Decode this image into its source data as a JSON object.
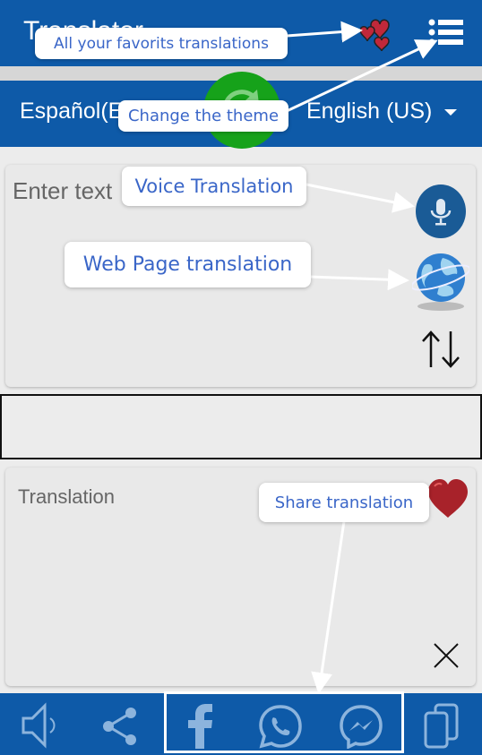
{
  "header": {
    "title": "Translator",
    "favorites_icon": "hearts-icon",
    "menu_icon": "list-menu-icon"
  },
  "languages": {
    "source": "Español(E",
    "target": "English (US)",
    "swap_icon": "refresh-icon"
  },
  "input": {
    "placeholder": "Enter text",
    "mic_icon": "microphone-icon",
    "web_icon": "globe-icon",
    "swap_icon": "up-down-arrows-icon"
  },
  "output": {
    "placeholder": "Translation",
    "favorite_icon": "heart-icon",
    "clear_icon": "close-icon"
  },
  "bottom_bar": {
    "icons": [
      "speaker-icon",
      "share-icon",
      "facebook-icon",
      "whatsapp-icon",
      "messenger-icon",
      "copy-icon"
    ]
  },
  "callouts": {
    "favorites": "All your favorits translations",
    "theme": "Change the theme",
    "voice": "Voice Translation",
    "web": "Web Page translation",
    "share": "Share translation"
  },
  "colors": {
    "bar_blue": "#0e5aa8",
    "swap_green": "#16a21a",
    "callout_text": "#3a66c8",
    "heart_red": "#b3262e"
  }
}
